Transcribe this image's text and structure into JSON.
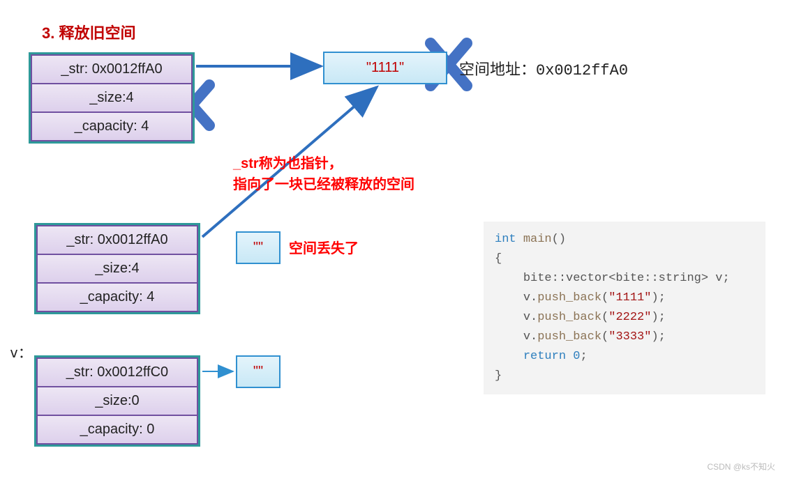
{
  "title": "3. 释放旧空间",
  "struct1": {
    "str": "_str: 0x0012ffA0",
    "size": "_size:4",
    "cap": "_capacity: 4"
  },
  "struct2": {
    "str": "_str: 0x0012ffA0",
    "size": "_size:4",
    "cap": "_capacity: 4"
  },
  "struct3": {
    "str": "_str: 0x0012ffC0",
    "size": "_size:0",
    "cap": "_capacity: 0"
  },
  "mem1": "\"1111\"",
  "small": "\"\"",
  "addr_label": "空间地址：0x0012ffA0",
  "anno1_line1": "_str称为也指针，",
  "anno1_line2": "指向了一块已经被释放的空间",
  "anno2": "空间丢失了",
  "vlabel": "v：",
  "code": {
    "l1a": "int",
    "l1b": "main",
    "l3": "bite::vector<bite::string> v;",
    "l4a": "v.",
    "l4b": "push_back",
    "l4c": "\"1111\"",
    "l5c": "\"2222\"",
    "l6c": "\"3333\"",
    "l7a": "return",
    "l7b": "0"
  },
  "watermark": "CSDN @ks不知火"
}
